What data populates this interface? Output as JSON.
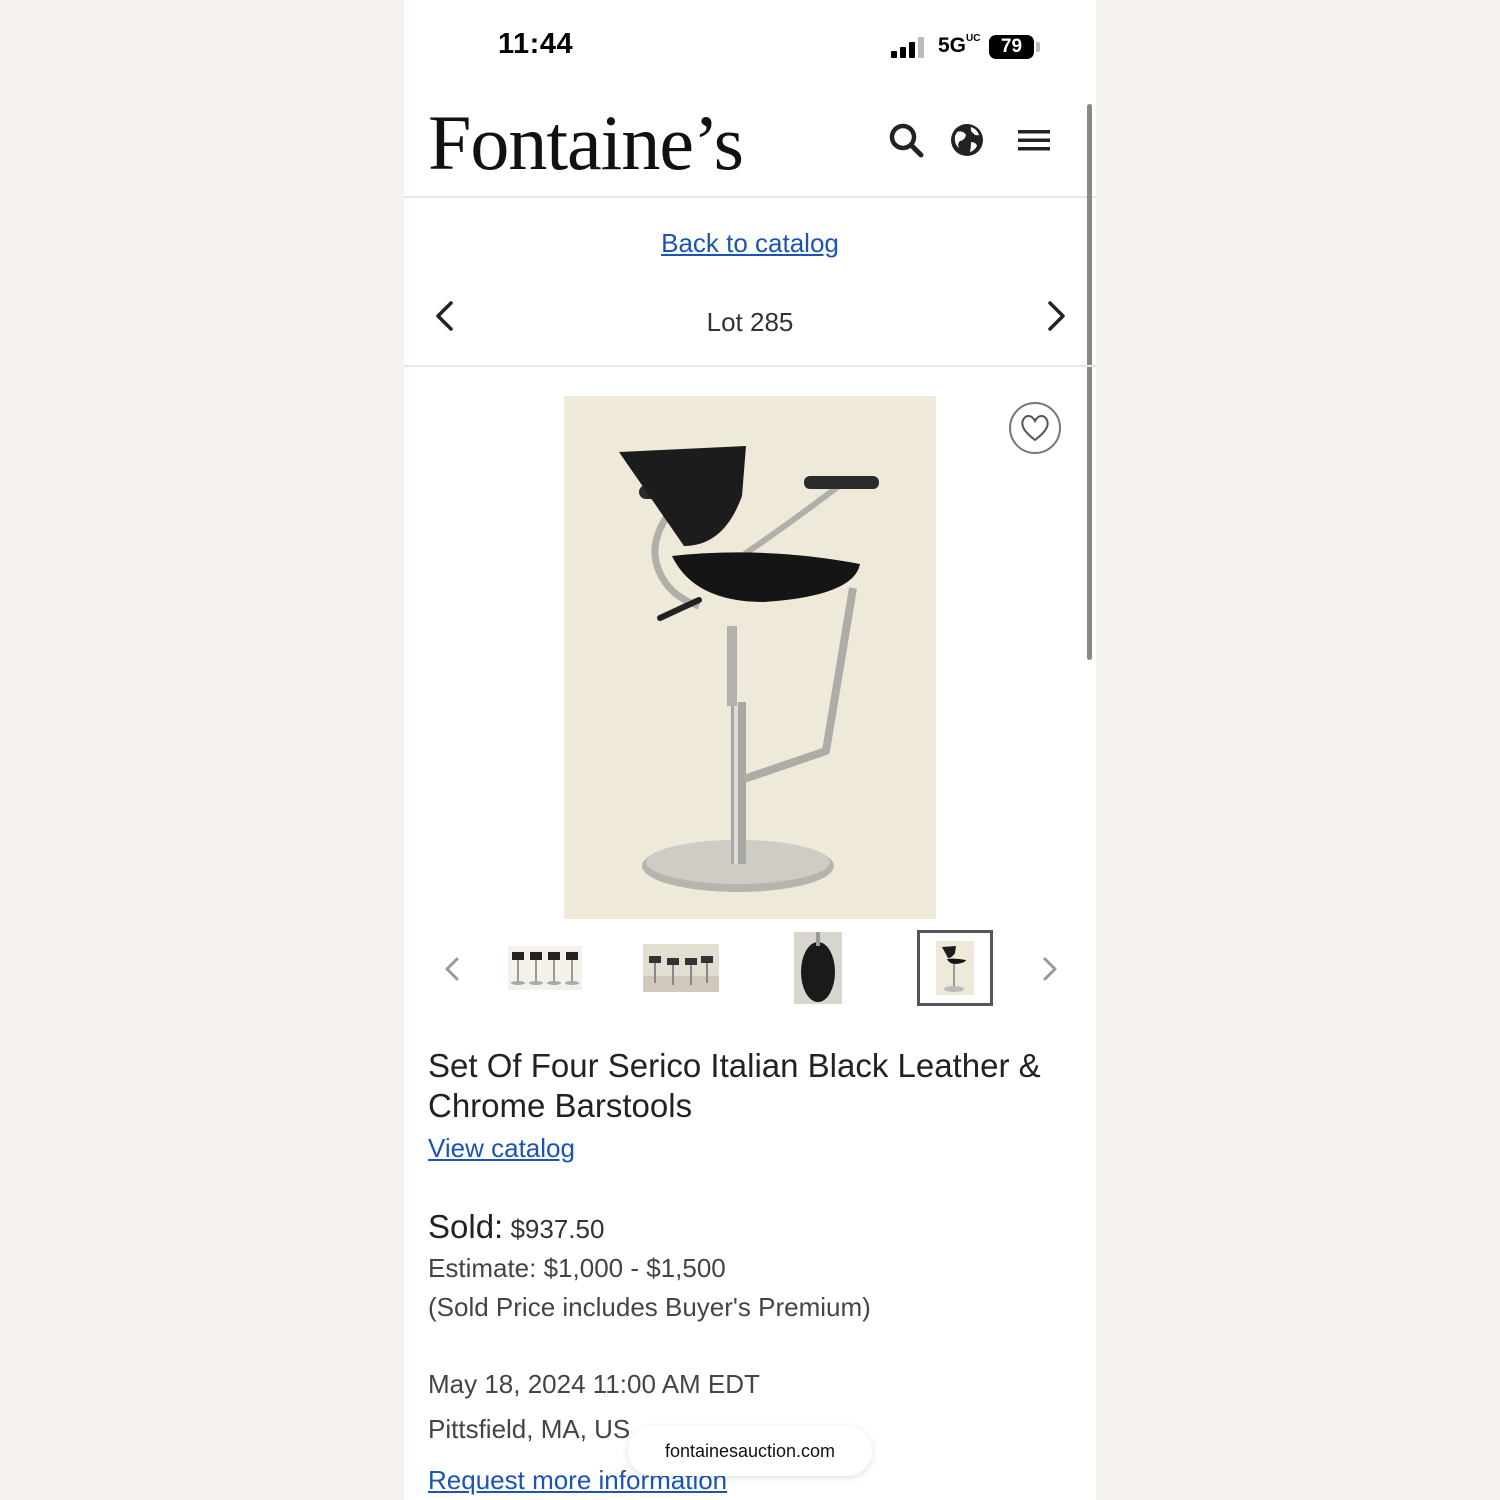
{
  "status_bar": {
    "time": "11:44",
    "network": "5G",
    "network_suffix": "UC",
    "battery": "79"
  },
  "header": {
    "logo": "Fontaine’s",
    "icons": [
      "search-icon",
      "globe-icon",
      "menu-icon"
    ]
  },
  "nav": {
    "back_link": "Back to catalog",
    "lot_label": "Lot 285"
  },
  "gallery": {
    "thumbnails": [
      "four barstools front",
      "four barstools in room",
      "seat detail",
      "single barstool"
    ],
    "active_thumbnail_index": 3
  },
  "lot": {
    "title": "Set Of Four Serico Italian Black Leather & Chrome Barstools",
    "view_catalog": "View catalog",
    "sold_label": "Sold:",
    "sold_price": "$937.50",
    "estimate": "Estimate: $1,000 - $1,500",
    "premium_note": "(Sold Price includes Buyer's Premium)",
    "date": "May 18, 2024 11:00 AM EDT",
    "location": "Pittsfield, MA, US",
    "request_link": "Request more information"
  },
  "browser": {
    "domain": "fontainesauction.com"
  },
  "colors": {
    "link": "#1a55b5",
    "text": "#222222",
    "page_bg": "#f6f3ef"
  }
}
